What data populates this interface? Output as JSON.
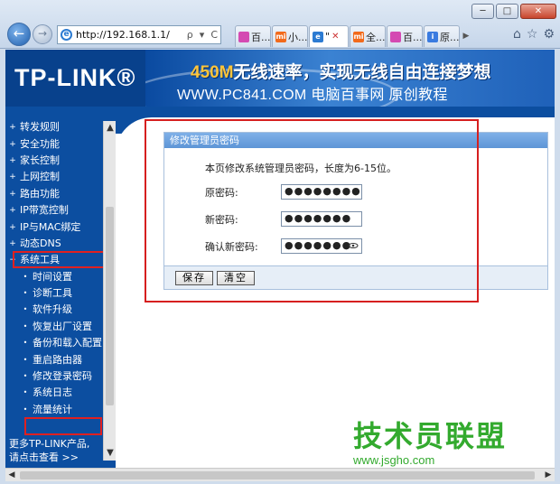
{
  "window": {
    "min": "─",
    "max": "□",
    "close": "✕"
  },
  "nav": {
    "back": "←",
    "forward": "→"
  },
  "address": {
    "url": "http://192.168.1.1/",
    "search_glyph": "ρ",
    "dropdown_glyph": "▾",
    "refresh_glyph": "C"
  },
  "tabs": [
    {
      "label": "百...",
      "fav_color": "#d44ab2",
      "fav_text": ""
    },
    {
      "label": "小...",
      "fav_color": "#f26a1b",
      "fav_text": "mi"
    },
    {
      "label": "\"",
      "fav_color": "#2c7bd2",
      "fav_text": "e",
      "active": true,
      "close": "✕"
    },
    {
      "label": "全...",
      "fav_color": "#f26a1b",
      "fav_text": "mi"
    },
    {
      "label": "百...",
      "fav_color": "#d44ab2",
      "fav_text": ""
    },
    {
      "label": "原...",
      "fav_color": "#3a7be0",
      "fav_text": "i"
    }
  ],
  "toolbar_icons": {
    "home": "⌂",
    "favorites": "☆",
    "settings": "⚙"
  },
  "banner": {
    "logo": "TP-LINK®",
    "tagline_speed": "450M",
    "tagline_rest": "无线速率，实现无线自由连接梦想",
    "watermark": "WWW.PC841.COM 电脑百事网 原创教程"
  },
  "sidebar": {
    "items": [
      {
        "label": "转发规则",
        "bullet": "+"
      },
      {
        "label": "安全功能",
        "bullet": "+"
      },
      {
        "label": "家长控制",
        "bullet": "+"
      },
      {
        "label": "上网控制",
        "bullet": "+"
      },
      {
        "label": "路由功能",
        "bullet": "+"
      },
      {
        "label": "IP带宽控制",
        "bullet": "+"
      },
      {
        "label": "IP与MAC绑定",
        "bullet": "+"
      },
      {
        "label": "动态DNS",
        "bullet": "+"
      },
      {
        "label": "系统工具",
        "bullet": "−"
      }
    ],
    "subitems": [
      {
        "label": "时间设置",
        "bullet": "•"
      },
      {
        "label": "诊断工具",
        "bullet": "•"
      },
      {
        "label": "软件升级",
        "bullet": "•"
      },
      {
        "label": "恢复出厂设置",
        "bullet": "•"
      },
      {
        "label": "备份和载入配置",
        "bullet": "•"
      },
      {
        "label": "重启路由器",
        "bullet": "•"
      },
      {
        "label": "修改登录密码",
        "bullet": "•"
      },
      {
        "label": "系统日志",
        "bullet": "•"
      },
      {
        "label": "流量统计",
        "bullet": "•"
      }
    ],
    "more_line1": "更多TP-LINK产品,",
    "more_line2": "请点击查看 >>"
  },
  "panel": {
    "title": "修改管理员密码",
    "description": "本页修改系统管理员密码，长度为6-15位。",
    "old_label": "原密码:",
    "old_value": "●●●●●●●●●●●",
    "new_label": "新密码:",
    "new_value": "●●●●●●●",
    "confirm_label": "确认新密码:",
    "confirm_value": "●●●●●●●",
    "eye_glyph": "👁",
    "save": "保存",
    "clear": "清空"
  },
  "watermark2": {
    "cn": "技术员联盟",
    "en": "www.jsgho.com"
  },
  "scroll": {
    "up": "▲",
    "down": "▼",
    "left": "◀",
    "right": "▶"
  }
}
